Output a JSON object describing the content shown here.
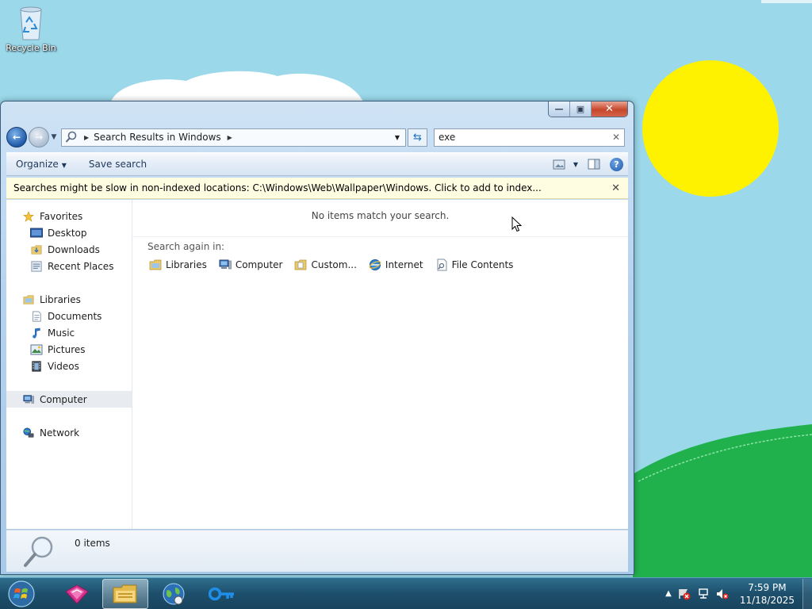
{
  "desktop": {
    "icons": [
      {
        "label": "Recycle Bin",
        "icon": "recycle-bin-icon"
      }
    ]
  },
  "explorer": {
    "title_buttons": {
      "minimize": "minimize-icon",
      "maximize": "maximize-icon",
      "close": "close-icon"
    },
    "address": {
      "breadcrumb": "Search Results in Windows"
    },
    "search": {
      "value": "exe"
    },
    "commands": {
      "organize": "Organize",
      "save_search": "Save search"
    },
    "infobar": {
      "text": "Searches might be slow in non-indexed locations: C:\\Windows\\Web\\Wallpaper\\Windows. Click to add to index..."
    },
    "nav": {
      "favorites": {
        "label": "Favorites",
        "items": [
          "Desktop",
          "Downloads",
          "Recent Places"
        ]
      },
      "libraries": {
        "label": "Libraries",
        "items": [
          "Documents",
          "Music",
          "Pictures",
          "Videos"
        ]
      },
      "computer": "Computer",
      "network": "Network"
    },
    "results": {
      "empty_message": "No items match your search.",
      "search_again_label": "Search again in:",
      "locations": [
        "Libraries",
        "Computer",
        "Custom...",
        "Internet",
        "File Contents"
      ]
    },
    "details": {
      "count": "0 items"
    }
  },
  "taskbar": {
    "pinned": [
      "windows-start-icon",
      "paint-app-icon",
      "file-explorer-icon",
      "internet-globe-icon",
      "key-app-icon"
    ],
    "clock": {
      "time": "7:59 PM",
      "date": "11/18/2025"
    }
  }
}
